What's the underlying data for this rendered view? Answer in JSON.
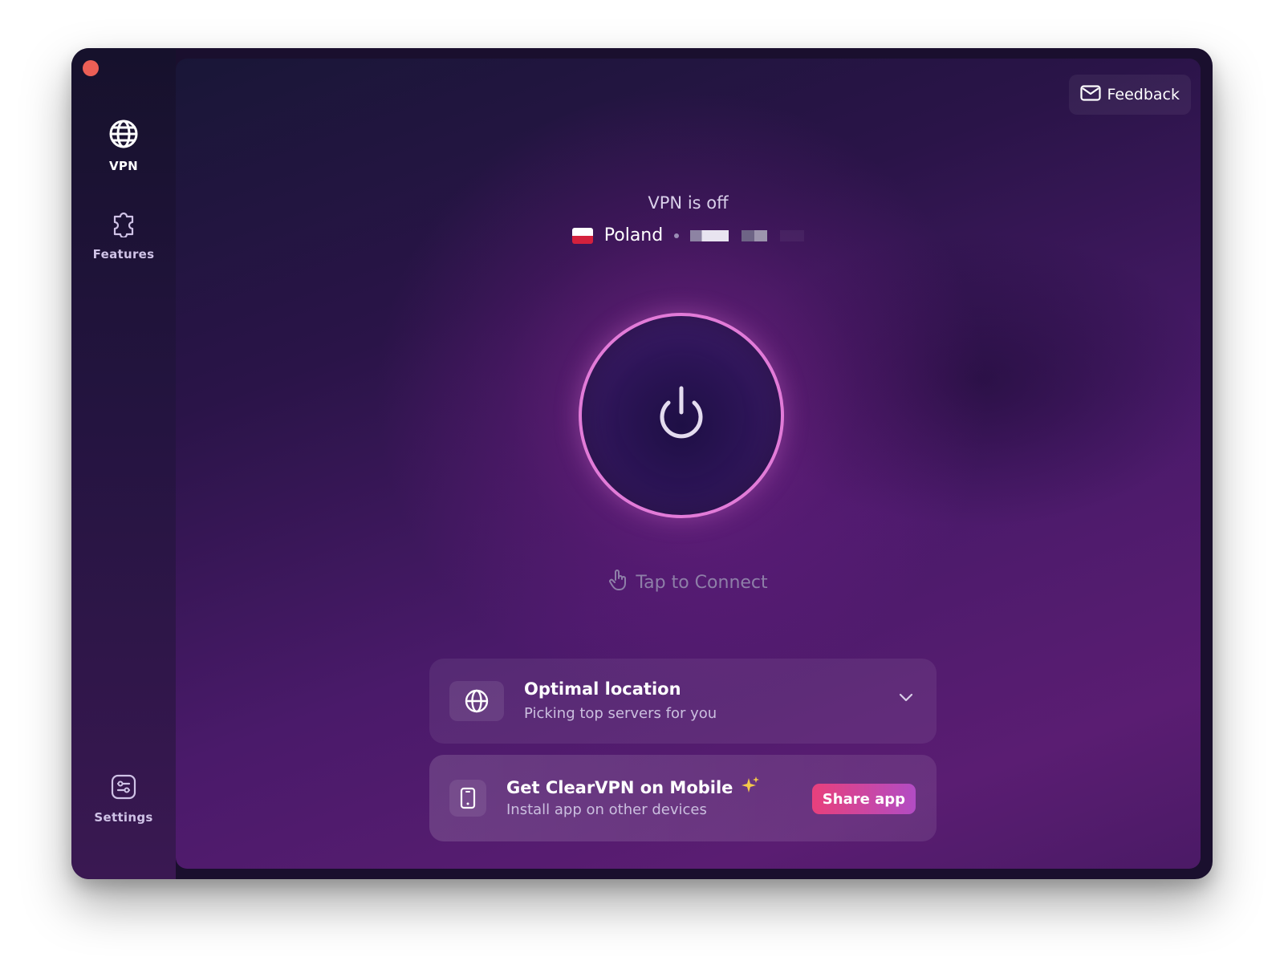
{
  "sidebar": {
    "items": [
      {
        "label": "VPN",
        "icon": "globe-icon",
        "active": true
      },
      {
        "label": "Features",
        "icon": "puzzle-icon",
        "active": false
      },
      {
        "label": "Settings",
        "icon": "settings-icon",
        "active": false
      }
    ]
  },
  "header": {
    "feedback_label": "Feedback",
    "feedback_icon": "mail-icon"
  },
  "status": {
    "title": "VPN is off",
    "country": "Poland",
    "flag_icon": "poland-flag-icon",
    "tap_hint": "Tap to Connect",
    "tap_icon": "hand-pointer-icon"
  },
  "location_card": {
    "title": "Optimal location",
    "subtitle": "Picking top servers for you",
    "icon": "globe-icon"
  },
  "mobile_card": {
    "title": "Get ClearVPN on Mobile",
    "sparkle_icon": "sparkle-icon",
    "subtitle": "Install app on other devices",
    "button_label": "Share app",
    "icon": "phone-icon"
  },
  "colors": {
    "accent_ring": "#e27bd8",
    "share_gradient_start": "#e8407c",
    "share_gradient_end": "#b24cc4",
    "close_dot": "#ec5f56"
  }
}
